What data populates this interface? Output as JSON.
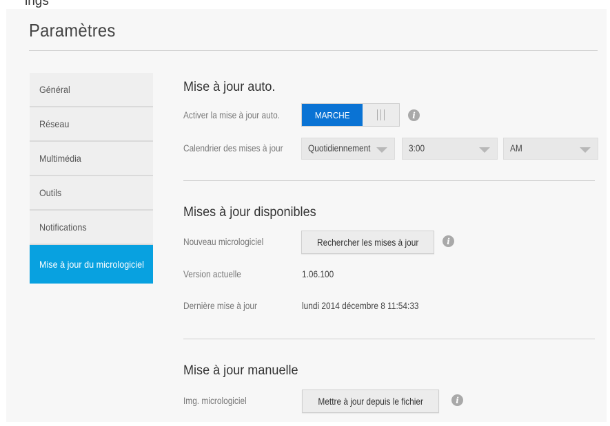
{
  "top_partial_text": "ings",
  "page_title": "Paramètres",
  "sidebar": {
    "items": [
      {
        "label": "Général"
      },
      {
        "label": "Réseau"
      },
      {
        "label": "Multimédia"
      },
      {
        "label": "Outils"
      },
      {
        "label": "Notifications"
      },
      {
        "label": "Mise à jour du micrologiciel"
      }
    ],
    "active_index": 5
  },
  "auto_update": {
    "title": "Mise à jour auto.",
    "enable_label": "Activer la mise à jour auto.",
    "toggle_on_label": "MARCHE",
    "toggle_state": "on",
    "schedule_label": "Calendrier des mises à jour",
    "frequency_value": "Quotidiennement",
    "time_value": "3:00",
    "ampm_value": "AM"
  },
  "available_updates": {
    "title": "Mises à jour disponibles",
    "new_firmware_label": "Nouveau micrologiciel",
    "check_button_label": "Rechercher les mises à jour",
    "current_version_label": "Version actuelle",
    "current_version_value": "1.06.100",
    "last_update_label": "Dernière mise à jour",
    "last_update_value": "lundi 2014 décembre 8 11:54:33"
  },
  "manual_update": {
    "title": "Mise à jour manuelle",
    "image_label": "Img. micrologiciel",
    "update_button_label": "Mettre à jour depuis le fichier"
  },
  "icons": {
    "info": "info-icon"
  },
  "colors": {
    "accent": "#08a1e0",
    "toggle_on": "#0a73d4",
    "panel_bg": "#f7f7f7"
  }
}
